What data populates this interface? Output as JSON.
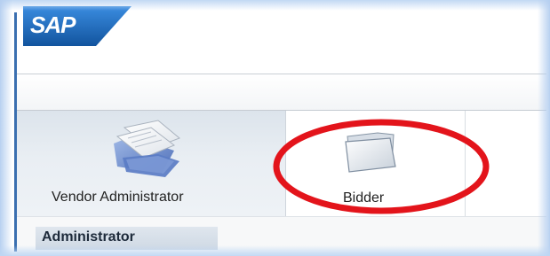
{
  "header": {
    "logo_text": "SAP"
  },
  "nav": {
    "items": [
      {
        "label": "Vendor Administrator",
        "icon": "documents-folder-icon"
      },
      {
        "label": "Bidder",
        "icon": "folder-icon"
      }
    ],
    "section_label": "Administrator"
  },
  "annotation": {
    "highlight_color": "#e3141b"
  },
  "colors": {
    "logo_blue": "#1f6fc1",
    "accent_rule": "#3a6fb0"
  }
}
